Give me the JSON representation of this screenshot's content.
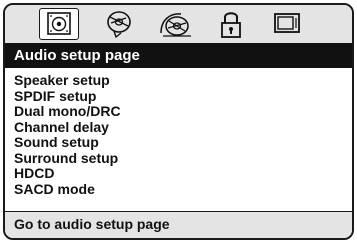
{
  "tabs": [
    {
      "icon": "speaker-icon",
      "selected": true
    },
    {
      "icon": "disc-icon",
      "selected": false
    },
    {
      "icon": "audio-disc-icon",
      "selected": false
    },
    {
      "icon": "lock-icon",
      "selected": false
    },
    {
      "icon": "tv-icon",
      "selected": false
    }
  ],
  "page": {
    "title": "Audio setup page"
  },
  "menu": {
    "items": [
      {
        "label": "Speaker setup"
      },
      {
        "label": "SPDIF setup"
      },
      {
        "label": "Dual mono/DRC"
      },
      {
        "label": "Channel delay"
      },
      {
        "label": "Sound setup"
      },
      {
        "label": "Surround setup"
      },
      {
        "label": "HDCD"
      },
      {
        "label": "SACD mode"
      }
    ]
  },
  "status": {
    "text": "Go to audio setup page"
  }
}
